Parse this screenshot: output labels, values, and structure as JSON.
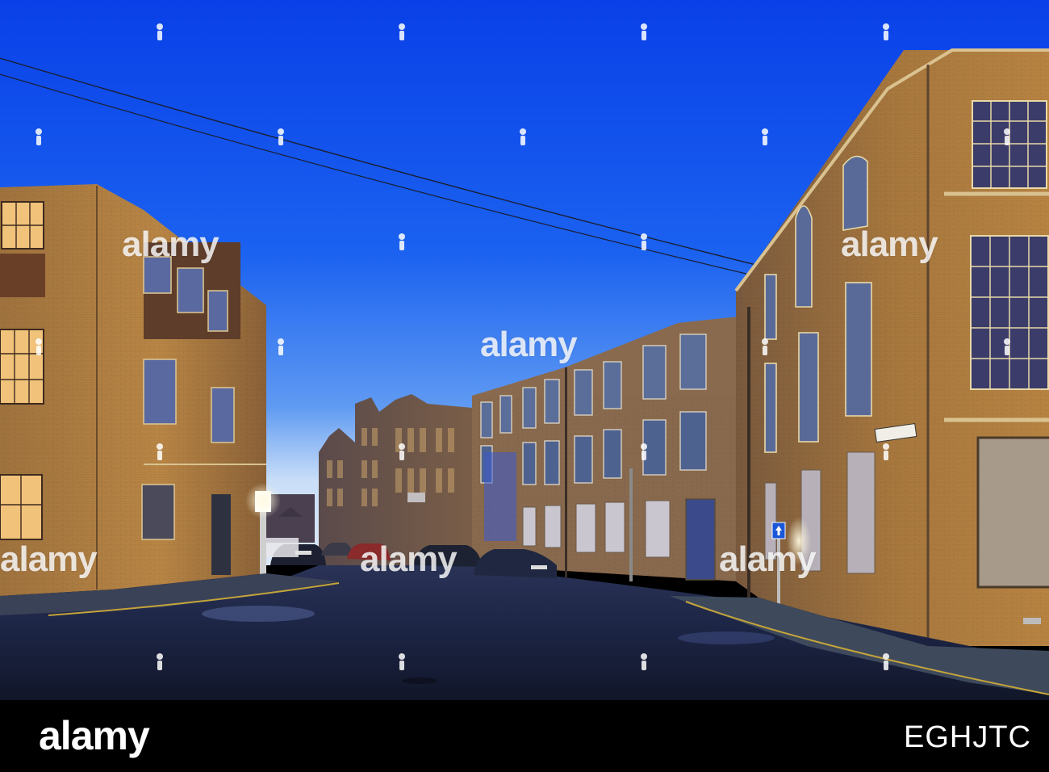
{
  "scene": {
    "colors": {
      "sky_top": "#0a48ee",
      "sky_mid": "#1f66f0",
      "sky_horizon": "#c8dcf8",
      "brick_lit": "#b78340",
      "brick_dark": "#6a4a30",
      "road": "#1b2240",
      "window_glow": "#e9c27a"
    },
    "street_sign": "",
    "one_way_sign_icon": "arrow-up-icon"
  },
  "watermark": {
    "text": "alamy",
    "icon": "alamy-dot-icon"
  },
  "footer": {
    "brand": "alamy",
    "image_id": "EGHJTC"
  }
}
